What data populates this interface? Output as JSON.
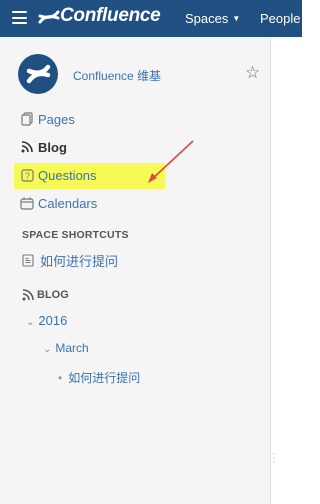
{
  "topbar": {
    "logo_text": "Confluence",
    "spaces_label": "Spaces",
    "people_label": "People"
  },
  "sidebar": {
    "space_name": "Confluence 维基",
    "nav_items": [
      {
        "label": "Pages"
      },
      {
        "label": "Blog"
      },
      {
        "label": "Questions"
      },
      {
        "label": "Calendars"
      }
    ],
    "shortcuts_title": "SPACE SHORTCUTS",
    "shortcut_label": "如何进行提问",
    "blog_title": "BLOG",
    "tree": {
      "year": "2016",
      "month": "March",
      "post": "如何进行提问"
    }
  },
  "colors": {
    "header_bg": "#205081",
    "link": "#3b73af",
    "highlight": "#f6fa3a",
    "arrow": "#e04a3a"
  }
}
